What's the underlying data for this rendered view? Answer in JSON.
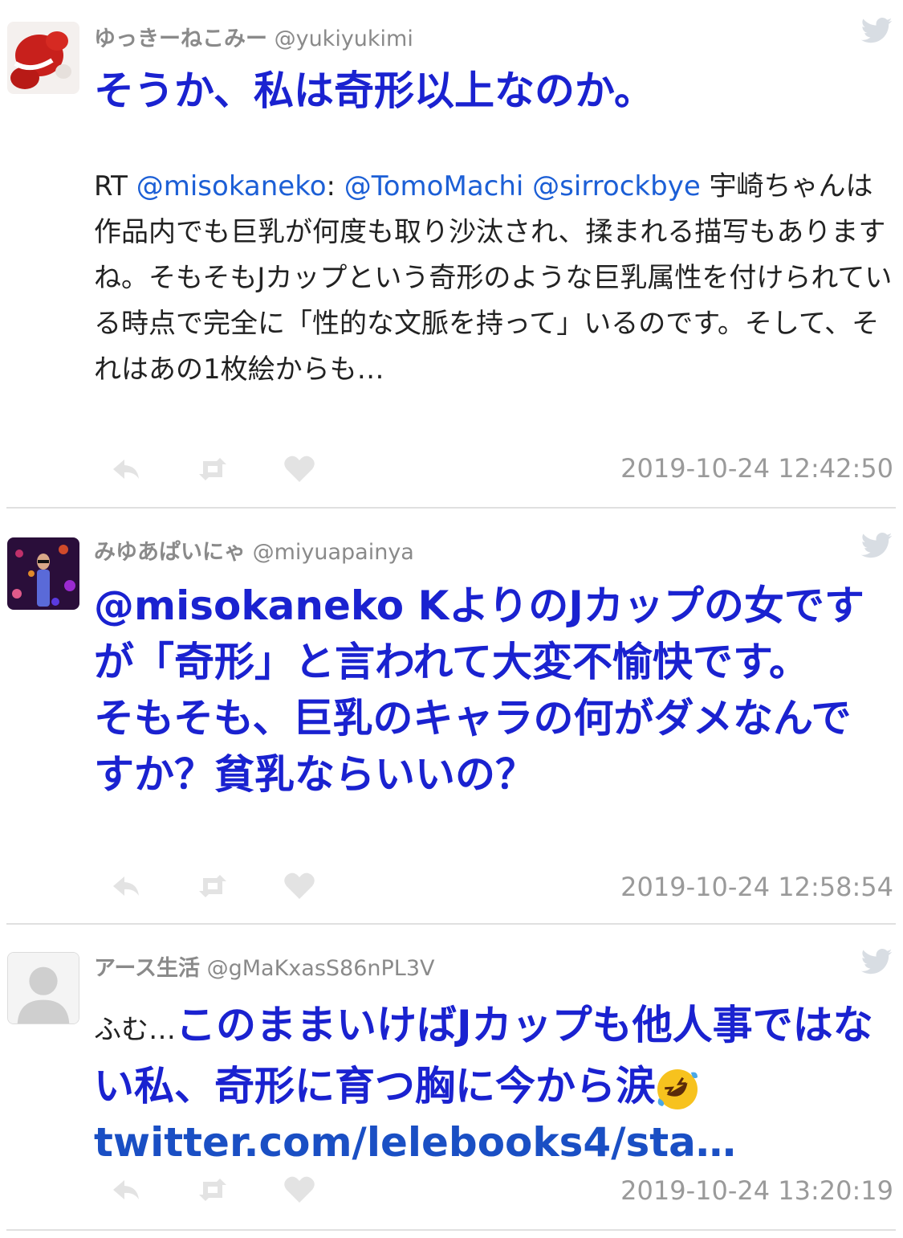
{
  "colors": {
    "accent_blue": "#1a22d0",
    "mention_blue": "#1c5fd6",
    "gray": "#9a9a9a",
    "twitter_bird": "#d8dde3"
  },
  "tweets": [
    {
      "name": "ゆっきーねこみー",
      "handle": "@yukiyukimi",
      "headline": "そうか、私は奇形以上なのか。",
      "rt_prefix": "RT ",
      "rt_user": "@misokaneko",
      "rt_colon": ": ",
      "rt_m1": "@TomoMachi",
      "rt_m2": "@sirrockbye",
      "rt_text": " 宇崎ちゃんは作品内でも巨乳が何度も取り沙汰され、揉まれる描写もありますね。そもそもJカップという奇形のような巨乳属性を付けられている時点で完全に「性的な文脈を持って」いるのです。そして、それはあの1枚絵からも…",
      "timestamp": "2019-10-24 12:42:50",
      "icons": [
        "reply-icon",
        "retweet-icon",
        "heart-icon",
        "twitter-bird-icon"
      ]
    },
    {
      "name": "みゆあぱいにゃ",
      "handle": "@miyuapainya",
      "text": "@misokaneko Kよりの​Jカップの女ですが「奇形」と言われて大変不愉快です。\nそもそも、巨乳のキャラの何がダメなんですか？貧乳ならいいの？",
      "timestamp": "2019-10-24 12:58:54",
      "icons": [
        "reply-icon",
        "retweet-icon",
        "heart-icon",
        "twitter-bird-icon"
      ]
    },
    {
      "name": "アース生活",
      "handle": "@gMaKxasS86nPL3V",
      "prefix": "ふむ…",
      "text": "このままいけばJカップも他人事ではない私、奇形に育つ胸に今から涙",
      "emoji": "rolling-on-floor-laughing-emoji",
      "link": "twitter.com/lelebooks4/sta…",
      "timestamp": "2019-10-24 13:20:19",
      "icons": [
        "reply-icon",
        "retweet-icon",
        "heart-icon",
        "twitter-bird-icon"
      ]
    }
  ]
}
